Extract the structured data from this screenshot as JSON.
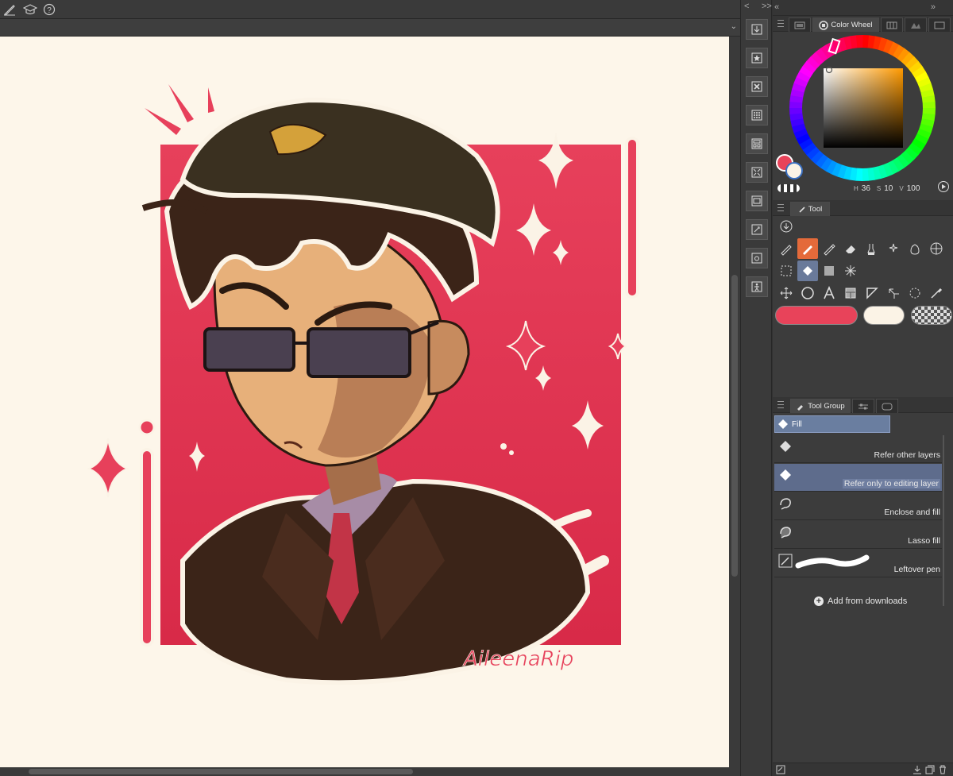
{
  "colors": {
    "main_color": "#e8435a",
    "sub_color": "#fbf3e6",
    "accent_selected": "#e46a3a",
    "canvas_bg": "#fdf6ea"
  },
  "toolbar": {
    "icons": [
      "pen-icon",
      "graduation-cap-icon",
      "help-icon"
    ]
  },
  "icon_strip": {
    "nav": [
      "<",
      ">>"
    ],
    "buttons": [
      "download-material-icon",
      "favorite-material-icon",
      "delete-material-icon",
      "tone-pattern-icon",
      "frame-icon",
      "manga-icon",
      "image-material-icon",
      "3d-material-icon",
      "camera-icon",
      "pose-icon"
    ]
  },
  "color_panel": {
    "tab_label": "Color Wheel",
    "collapse_chevrons": [
      "«",
      "»"
    ],
    "readout": {
      "h": "36",
      "s": "10",
      "v": "100"
    }
  },
  "tool_panel": {
    "tab_label": "Tool"
  },
  "tool_group": {
    "tab_label": "Tool Group",
    "group_name": "Fill",
    "sub_tools": [
      {
        "name": "Refer other layers",
        "selected": false
      },
      {
        "name": "Refer only to editing layer",
        "selected": true
      },
      {
        "name": "Enclose and fill",
        "selected": false
      },
      {
        "name": "Lasso fill",
        "selected": false
      },
      {
        "name": "Leftover pen",
        "selected": false
      }
    ],
    "add_from_downloads": "Add from downloads"
  },
  "artwork": {
    "signature": "AileenaRip"
  }
}
